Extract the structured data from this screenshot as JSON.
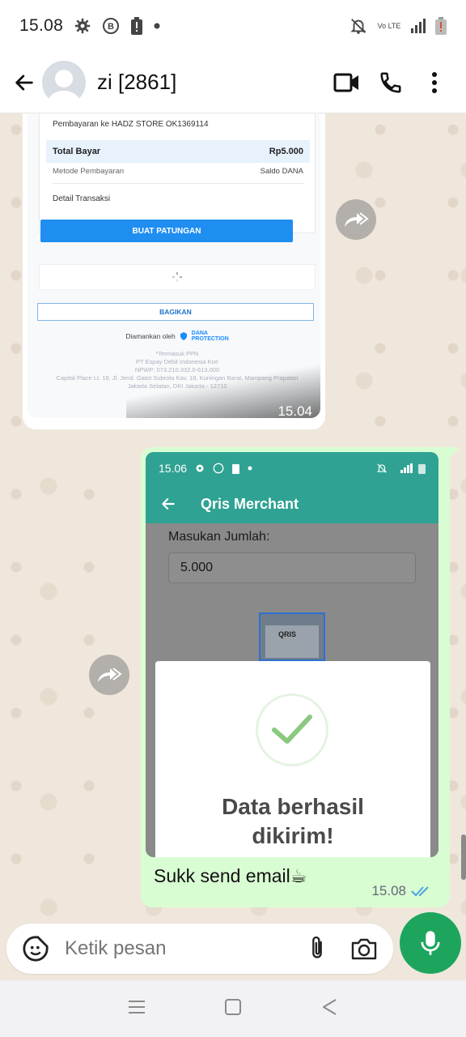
{
  "status_bar": {
    "time": "15.08",
    "network": "Vo LTE"
  },
  "header": {
    "contact_name": "zi [2861]"
  },
  "message1": {
    "receipt": {
      "merchant": "Pembayaran ke HADZ STORE OK1369114",
      "total_label": "Total Bayar",
      "total_value": "Rp5.000",
      "method_label": "Metode Pembayaran",
      "method_value": "Saldo DANA",
      "detail_label": "Detail Transaksi",
      "split_button": "BUAT PATUNGAN",
      "share_button": "BAGIKAN",
      "secured_by": "Diamankan oleh",
      "dana_logo_line1": "DANA",
      "dana_logo_line2": "PROTECTION",
      "footer_lines": [
        "*Termasuk PPN",
        "PT Espay Debit Indonesia Koe",
        "NPWP: 073.210.332.0-613.000",
        "Capital Place Lt. 18, Jl. Jend. Gatot Subroto Kav. 18, Kuningan Barat, Mampang Prapatan",
        "Jakarta Selatan, DKI Jakarta - 12710"
      ]
    },
    "time": "15.04"
  },
  "message2": {
    "screenshot": {
      "time": "15.06",
      "app_title": "Qris Merchant",
      "amount_label": "Masukan Jumlah:",
      "amount_value": "5.000",
      "qr_logo": "QRIS",
      "modal_text_line1": "Data berhasil",
      "modal_text_line2": "dikirim!"
    },
    "caption": "Sukk send email☕",
    "time": "15.08",
    "read_status": "double-check-read"
  },
  "input": {
    "placeholder": "Ketik pesan"
  },
  "colors": {
    "whatsapp_green": "#1da55e",
    "bubble_sent": "#d9fdd3",
    "app_teal": "#2fa293",
    "read_blue": "#4aa3df"
  }
}
